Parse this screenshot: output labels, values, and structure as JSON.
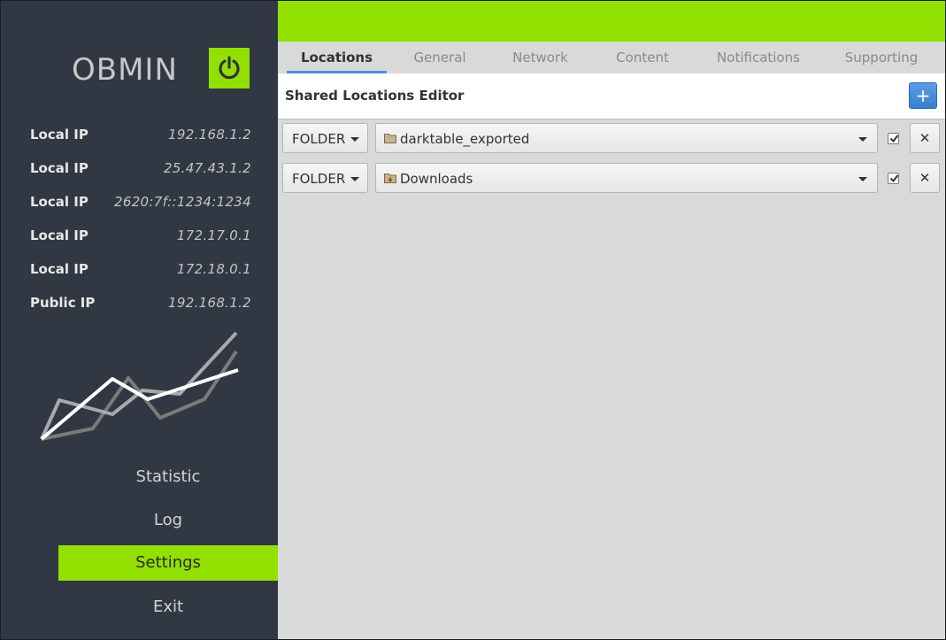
{
  "app": {
    "name": "OBMIN",
    "colors": {
      "accent": "#92e000",
      "sidebar": "#313844",
      "tab_underline": "#4a90d9"
    },
    "power_icon": "power-icon"
  },
  "ips": [
    {
      "label": "Local IP",
      "value": "192.168.1.2"
    },
    {
      "label": "Local IP",
      "value": "25.47.43.1.2"
    },
    {
      "label": "Local IP",
      "value": "2620:7f::1234:1234"
    },
    {
      "label": "Local IP",
      "value": "172.17.0.1"
    },
    {
      "label": "Local IP",
      "value": "172.18.0.1"
    },
    {
      "label": "Public IP",
      "value": "192.168.1.2"
    }
  ],
  "nav": [
    {
      "label": "Statistic"
    },
    {
      "label": "Log"
    },
    {
      "label": "Settings",
      "active": true
    },
    {
      "label": "Exit"
    }
  ],
  "tabs": [
    {
      "label": "Locations",
      "active": true
    },
    {
      "label": "General"
    },
    {
      "label": "Network"
    },
    {
      "label": "Content"
    },
    {
      "label": "Notifications"
    },
    {
      "label": "Supporting"
    }
  ],
  "editor": {
    "title": "Shared Locations Editor",
    "add_label": "+",
    "rows": [
      {
        "type": "FOLDER",
        "path": "darktable_exported",
        "path_icon": "folder-icon",
        "checked": true,
        "remove_label": "✕"
      },
      {
        "type": "FOLDER",
        "path": "Downloads",
        "path_icon": "downloads-folder-icon",
        "checked": true,
        "remove_label": "✕"
      }
    ]
  }
}
